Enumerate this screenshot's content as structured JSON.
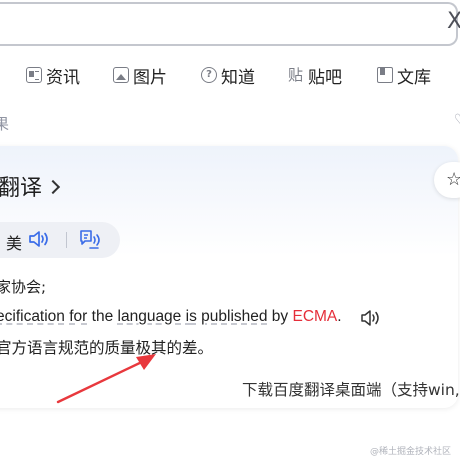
{
  "search": {
    "clear_symbol": "X"
  },
  "tabs": [
    {
      "label": "资讯",
      "icon": "news-icon"
    },
    {
      "label": "图片",
      "icon": "image-icon"
    },
    {
      "label": "知道",
      "icon": "question-icon"
    },
    {
      "label": "贴吧",
      "icon": "tieba-icon"
    },
    {
      "label": "文库",
      "icon": "document-icon"
    }
  ],
  "results": {
    "label": "果"
  },
  "card": {
    "title": "翻译",
    "pronunciation_label": "美",
    "definition": "家协会;",
    "example_en": [
      {
        "text": "ecification",
        "style": "u"
      },
      {
        "text": " ",
        "style": ""
      },
      {
        "text": "for",
        "style": "u"
      },
      {
        "text": " the ",
        "style": ""
      },
      {
        "text": "language",
        "style": "u"
      },
      {
        "text": " ",
        "style": ""
      },
      {
        "text": "is",
        "style": "u"
      },
      {
        "text": " ",
        "style": ""
      },
      {
        "text": "published",
        "style": "u"
      },
      {
        "text": " by ",
        "style": ""
      },
      {
        "text": "ECMA",
        "style": "hl"
      },
      {
        "text": ".",
        "style": ""
      }
    ],
    "example_zh": "官方语言规范的质量极其的差。",
    "download_text": "下载百度翻译桌面端（支持win,"
  },
  "watermark": "@稀土掘金技术社区",
  "colors": {
    "highlight": "#e52e3a",
    "accent_blue": "#3a6ce8",
    "arrow_red": "#e8383d",
    "muted": "#9195a3"
  }
}
